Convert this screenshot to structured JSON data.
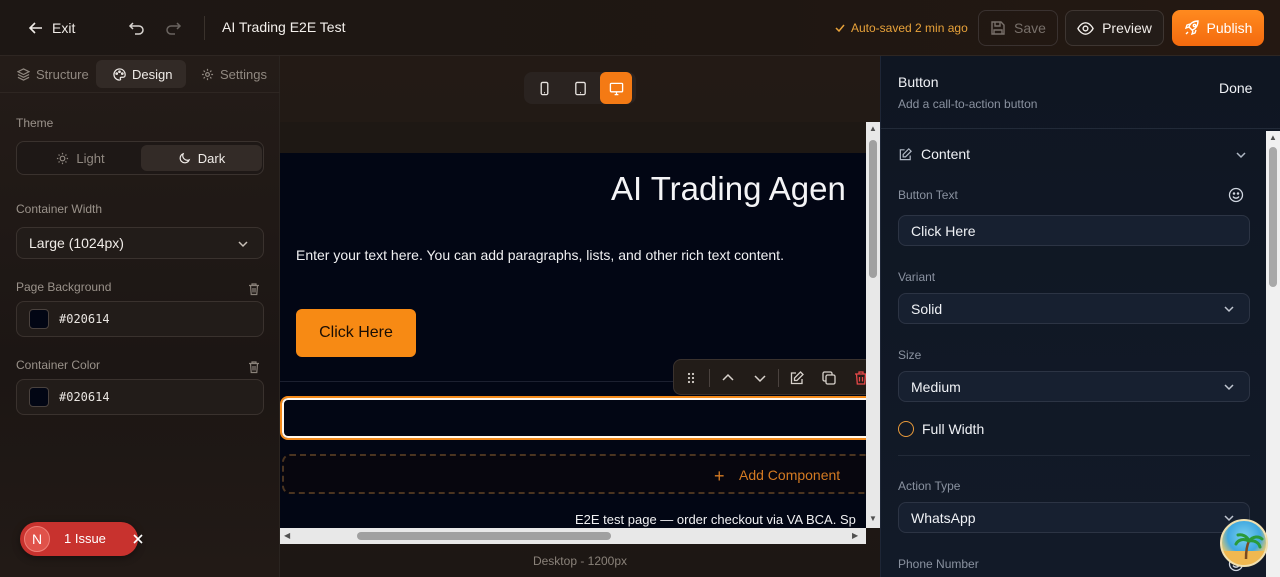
{
  "topbar": {
    "exit_label": "Exit",
    "title": "AI Trading E2E Test",
    "autosave": "Auto-saved 2 min ago",
    "save_label": "Save",
    "preview_label": "Preview",
    "publish_label": "Publish"
  },
  "left_panel": {
    "tabs": [
      "Structure",
      "Design",
      "Settings"
    ],
    "active_tab": "Design",
    "theme_label": "Theme",
    "theme_options": [
      "Light",
      "Dark"
    ],
    "theme_selected": "Dark",
    "container_width_label": "Container Width",
    "container_width_value": "Large (1024px)",
    "page_background_label": "Page Background",
    "page_background_value": "#020614",
    "container_color_label": "Container Color",
    "container_color_value": "#020614"
  },
  "issues": {
    "avatar_letter": "N",
    "label": "1 Issue"
  },
  "canvas": {
    "hero_title": "AI Trading Agen",
    "hero_text": "Enter your text here. You can add paragraphs, lists, and other rich text content.",
    "hero_button": "Click Here",
    "add_component_label": "Add Component",
    "footer_text": "E2E test page — order checkout via VA BCA. Sp",
    "device_label": "Desktop - 1200px",
    "active_device": "desktop"
  },
  "right_panel": {
    "title": "Button",
    "subtitle": "Add a call-to-action button",
    "done_label": "Done",
    "section_title": "Content",
    "button_text_label": "Button Text",
    "button_text_value": "Click Here",
    "variant_label": "Variant",
    "variant_value": "Solid",
    "size_label": "Size",
    "size_value": "Medium",
    "full_width_label": "Full Width",
    "action_type_label": "Action Type",
    "action_type_value": "WhatsApp",
    "phone_label": "Phone Number"
  },
  "colors": {
    "accent": "#f47a14",
    "page_bg": "#020614",
    "issue_red": "#c8322e"
  }
}
